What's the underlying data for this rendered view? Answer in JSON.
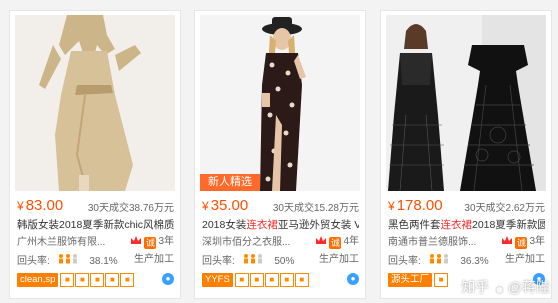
{
  "cards": [
    {
      "price_symbol": "¥",
      "price": "83.00",
      "sold": "30天成交38.76万元",
      "title_pre": "韩版女装2018夏季新款chic风棉质...",
      "title_hl": "",
      "title_post": "",
      "shop": "广州木兰服饰有限...",
      "years": "3年",
      "rate_label": "回头率:",
      "rate": "38.1%",
      "mode": "生产加工",
      "tag": "clean,sp",
      "badge": ""
    },
    {
      "price_symbol": "¥",
      "price": "35.00",
      "sold": "30天成交15.28万元",
      "title_pre": "2018女装",
      "title_hl": "连衣裙",
      "title_post": "亚马逊外贸女装 V...",
      "shop": "深圳市佰分之衣服...",
      "years": "4年",
      "rate_label": "回头率:",
      "rate": "50%",
      "mode": "生产加工",
      "tag": "YYFS",
      "badge": "新人精选"
    },
    {
      "price_symbol": "¥",
      "price": "178.00",
      "sold": "30天成交2.62万元",
      "title_pre": "黑色两件套",
      "title_hl": "连衣裙",
      "title_post": "2018夏季新款圆...",
      "shop": "南通市普兰德服饰...",
      "years": "3年",
      "rate_label": "回头率:",
      "rate": "36.3%",
      "mode": "生产加工",
      "tag": "源头工厂",
      "badge": ""
    }
  ],
  "watermark": {
    "site": "知乎",
    "user": "@蒋陛"
  },
  "colors": {
    "price": "#ff5000",
    "highlight": "#ff2a2a",
    "tag": "#ff7f00",
    "badge": "#ff6a2a"
  }
}
